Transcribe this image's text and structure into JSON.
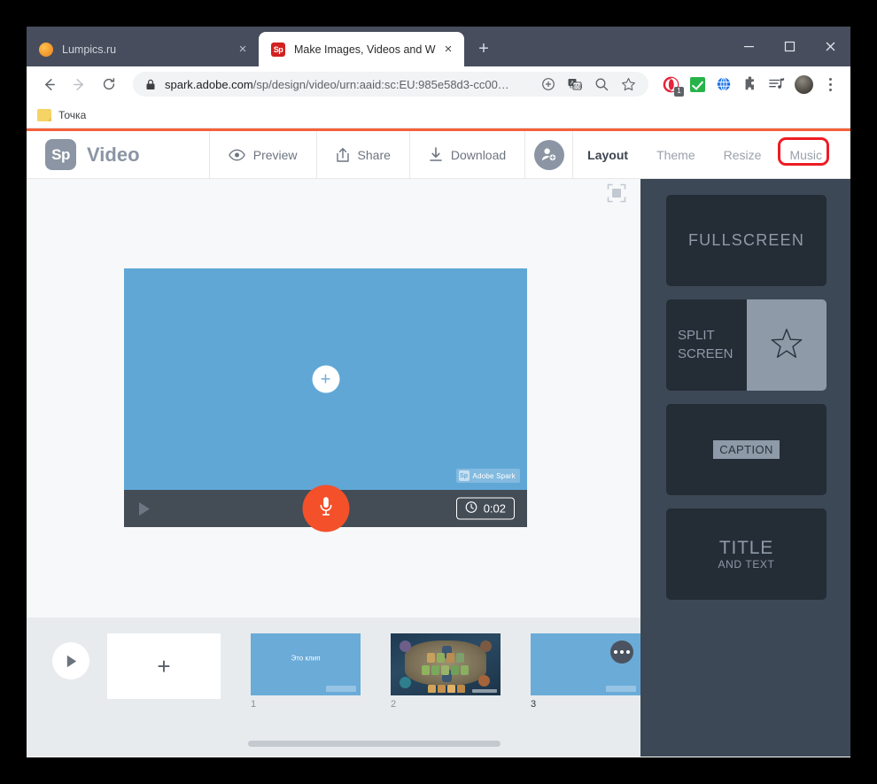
{
  "browser": {
    "tabs": [
      {
        "title": "Lumpics.ru",
        "favicon": "orange-circle-icon",
        "active": false,
        "close_label": "×"
      },
      {
        "title": "Make Images, Videos and Web S",
        "favicon": "spark-icon",
        "favicon_text": "Sp",
        "active": true,
        "close_label": "×"
      }
    ],
    "new_tab_label": "+",
    "window_controls": {
      "minimize": "minimize-icon",
      "maximize": "maximize-icon",
      "close": "close-icon"
    },
    "nav": {
      "back": "back-arrow-icon",
      "forward": "forward-arrow-icon",
      "reload": "reload-icon"
    },
    "omnibox": {
      "lock": "lock-icon",
      "url_domain": "spark.adobe.com",
      "url_path": "/sp/design/video/urn:aaid:sc:EU:985e58d3-cc00…",
      "icons": [
        "add-page-icon",
        "translate-icon",
        "zoom-out-icon",
        "bookmark-star-icon"
      ]
    },
    "extensions": [
      "opera-touch-icon",
      "green-check-icon",
      "globe-icon",
      "puzzle-icon",
      "playlist-music-icon"
    ],
    "extension_badge": "1",
    "profile": "avatar",
    "menu": "kebab-menu-icon",
    "bookmarks": [
      {
        "label": "Точка",
        "icon": "folder-icon"
      }
    ]
  },
  "app": {
    "brand": {
      "logo_text": "Sp",
      "name": "Video"
    },
    "toolbar": [
      {
        "label": "Preview",
        "icon": "eye-icon"
      },
      {
        "label": "Share",
        "icon": "share-upload-icon"
      },
      {
        "label": "Download",
        "icon": "download-icon"
      }
    ],
    "invite_icon": "add-person-icon",
    "tabs": [
      {
        "label": "Layout",
        "active": true,
        "highlighted": false
      },
      {
        "label": "Theme",
        "active": false,
        "highlighted": false
      },
      {
        "label": "Resize",
        "active": false,
        "highlighted": false
      },
      {
        "label": "Music",
        "active": false,
        "highlighted": true
      }
    ]
  },
  "canvas": {
    "expand_icon": "fullscreen-expand-icon",
    "add_media_label": "+",
    "watermark": {
      "logo": "Sp",
      "text": "Adobe Spark"
    },
    "controls": {
      "play_icon": "play-icon",
      "record_icon": "microphone-icon",
      "clock_icon": "clock-icon",
      "time": "0:02"
    }
  },
  "timeline": {
    "play_icon": "play-icon",
    "add_slide_label": "+",
    "slides": [
      {
        "number": "1",
        "caption": "Это клип",
        "type": "blue",
        "selected": false
      },
      {
        "number": "2",
        "caption": "",
        "type": "game",
        "selected": false
      },
      {
        "number": "3",
        "caption": "",
        "type": "blue",
        "selected": true,
        "menu_icon": "more-options-icon"
      }
    ],
    "scrollbar": "horizontal-scrollbar"
  },
  "sidebar": {
    "layouts": [
      {
        "id": "fullscreen",
        "label": "FULLSCREEN"
      },
      {
        "id": "split-screen",
        "label": "SPLIT\nSCREEN",
        "label_line1": "SPLIT",
        "label_line2": "SCREEN",
        "icon": "star-icon"
      },
      {
        "id": "caption",
        "label": "CAPTION"
      },
      {
        "id": "title-and-text",
        "title": "TITLE",
        "subtitle": "AND TEXT"
      }
    ]
  },
  "colors": {
    "accent": "#f5603b",
    "record": "#f4502a",
    "sidebar_bg": "#3c4856",
    "card_bg": "#242c36",
    "video_blue": "#60a7d6",
    "highlight_box": "#ee1c24"
  }
}
